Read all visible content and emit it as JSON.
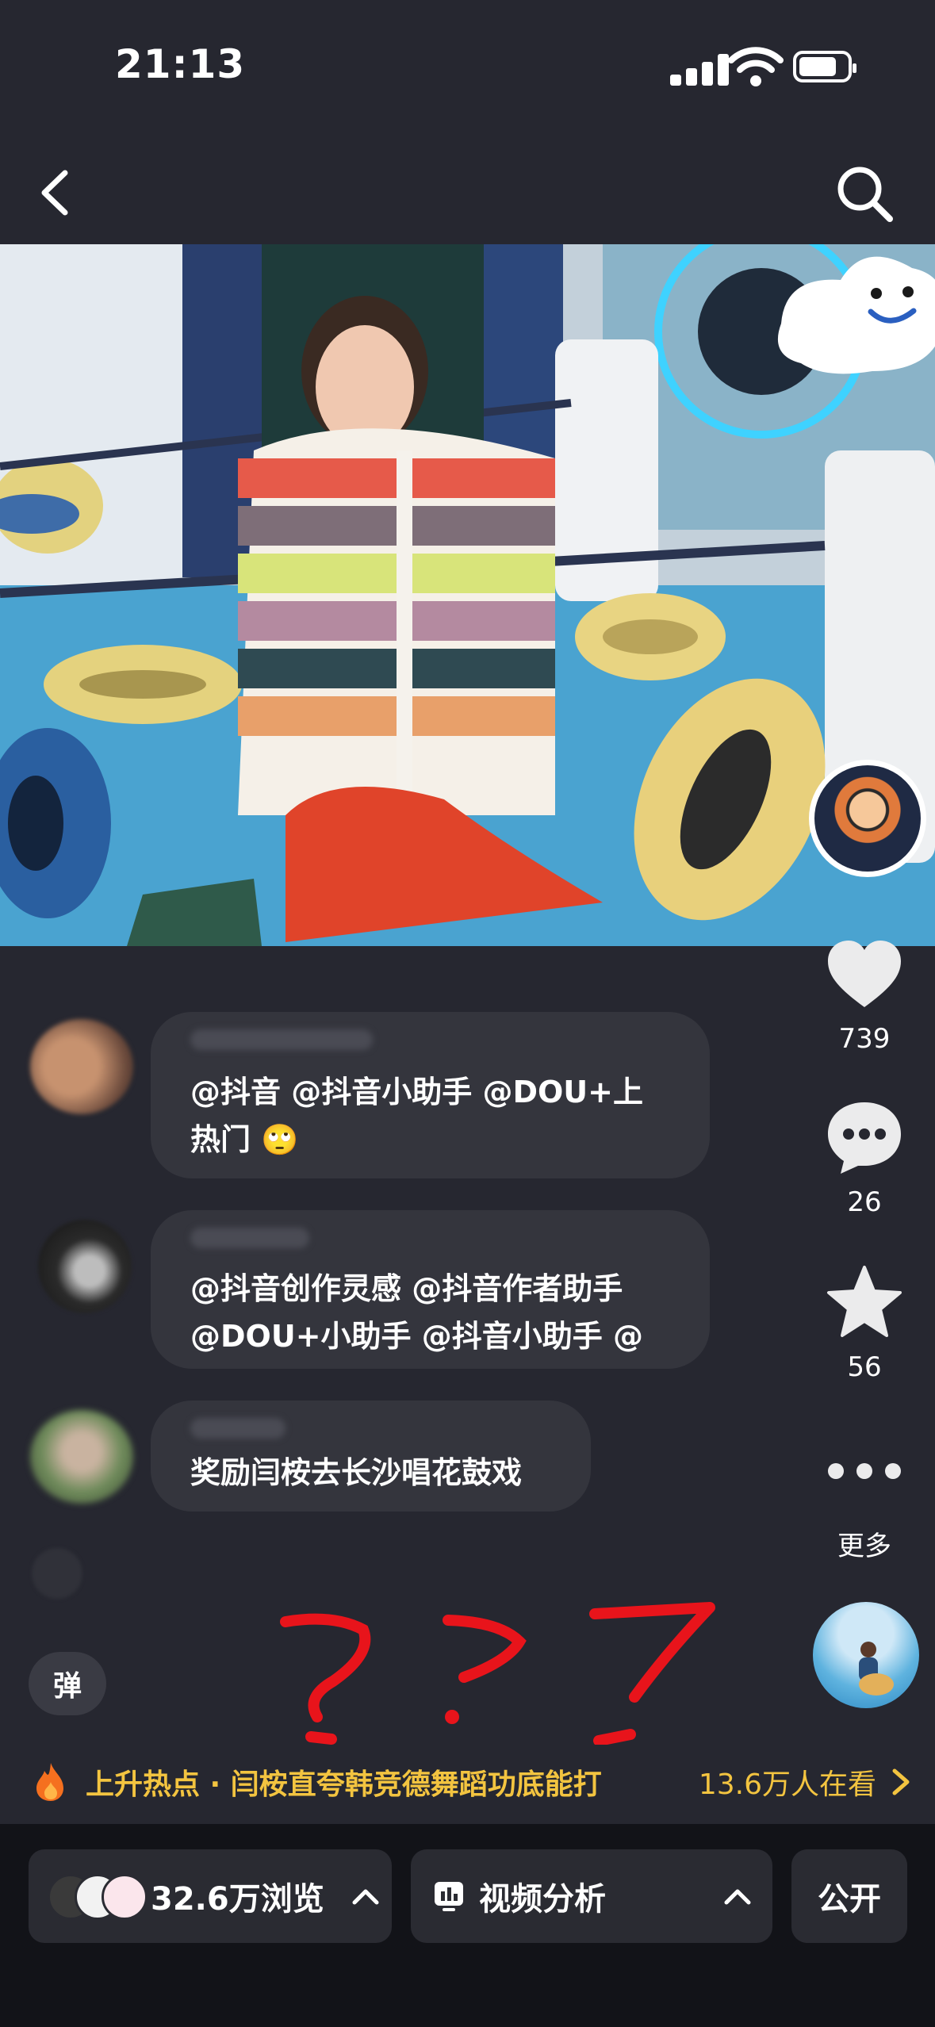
{
  "status": {
    "time": "21:13"
  },
  "rail": {
    "likes": "739",
    "comments": "26",
    "favorites": "56",
    "more_label": "更多"
  },
  "comments": [
    {
      "line1": "@抖音 @抖音小助手 @DOU+上",
      "line2": "热门 🙄"
    },
    {
      "line1": "@抖音创作灵感 @抖音作者助手",
      "line2": "@DOU+小助手 @抖音小助手 @"
    },
    {
      "line1": "奖励闫桉去长沙唱花鼓戏"
    }
  ],
  "danmu_label": "弹",
  "hot": {
    "title": "上升热点 · 闫桉直夸韩竞德舞蹈功底能打",
    "viewers": "13.6万人在看"
  },
  "bottom": {
    "views": "32.6万浏览",
    "analysis": "视频分析",
    "visibility": "公开"
  },
  "colors": {
    "background": "#262730",
    "accent": "#f3c440",
    "annotation": "#e8141b"
  }
}
